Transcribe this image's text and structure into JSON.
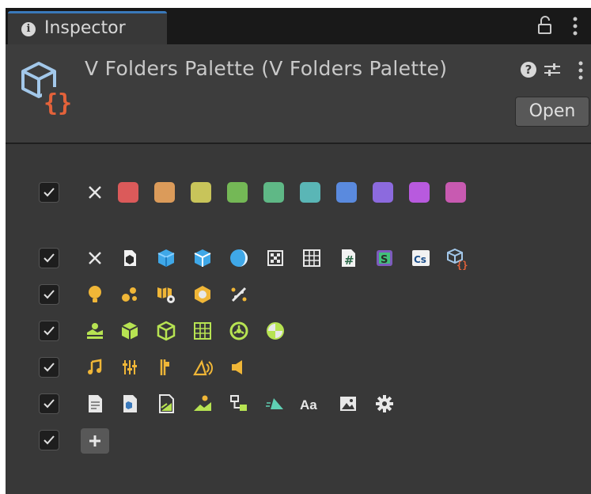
{
  "tab": {
    "title": "Inspector",
    "info_icon": "info-icon",
    "lock_icon": "lock-icon",
    "menu_icon": "kebab-menu-icon"
  },
  "header": {
    "title": "V Folders Palette (V Folders Palette)",
    "open_label": "Open",
    "asset_icon": "scriptable-object-icon"
  },
  "colors": {
    "swatches": [
      "#db5a5a",
      "#db9b5a",
      "#c8c45a",
      "#74b856",
      "#5fb886",
      "#5ab6b6",
      "#5a8ade",
      "#8c6ade",
      "#b85ade",
      "#c85ab1"
    ],
    "accent": "#3a79bb",
    "unity_yellow": "#f0b637",
    "unity_green": "#b7e352"
  },
  "rows": [
    {
      "type": "colors",
      "checked": true,
      "icons": [
        "none-icon"
      ]
    },
    {
      "type": "icons",
      "checked": true,
      "icons": [
        "none-icon",
        "prefab-icon",
        "cube-icon",
        "cube-variant-icon",
        "sphere-icon",
        "texture-icon",
        "grid-icon",
        "csharp-hash-icon",
        "shader-icon",
        "cs-script-icon",
        "scriptable-object-icon"
      ]
    },
    {
      "type": "icons",
      "checked": true,
      "icons": [
        "light-icon",
        "particle-icon",
        "lightmap-icon",
        "hexagon-icon",
        "sparkle-icon"
      ]
    },
    {
      "type": "icons",
      "checked": true,
      "icons": [
        "terrain-icon",
        "rigidbody-icon",
        "collider-icon",
        "mesh-grid-icon",
        "wheel-icon",
        "physics-material-icon"
      ]
    },
    {
      "type": "icons",
      "checked": true,
      "icons": [
        "audio-note-icon",
        "audio-mixer-icon",
        "audio-source-icon",
        "audio-listener-icon",
        "speaker-icon"
      ]
    },
    {
      "type": "icons",
      "checked": true,
      "icons": [
        "text-file-icon",
        "document-icon",
        "image-doc-icon",
        "landscape-icon",
        "hierarchy-icon",
        "triangle-icon",
        "font-icon",
        "picture-icon",
        "settings-gear-icon"
      ]
    },
    {
      "type": "add",
      "checked": true,
      "icons": [
        "plus-icon"
      ]
    }
  ],
  "font_icon_text": "Aa",
  "hash_text": "#",
  "shader_text": "S",
  "cs_text": "Cs"
}
